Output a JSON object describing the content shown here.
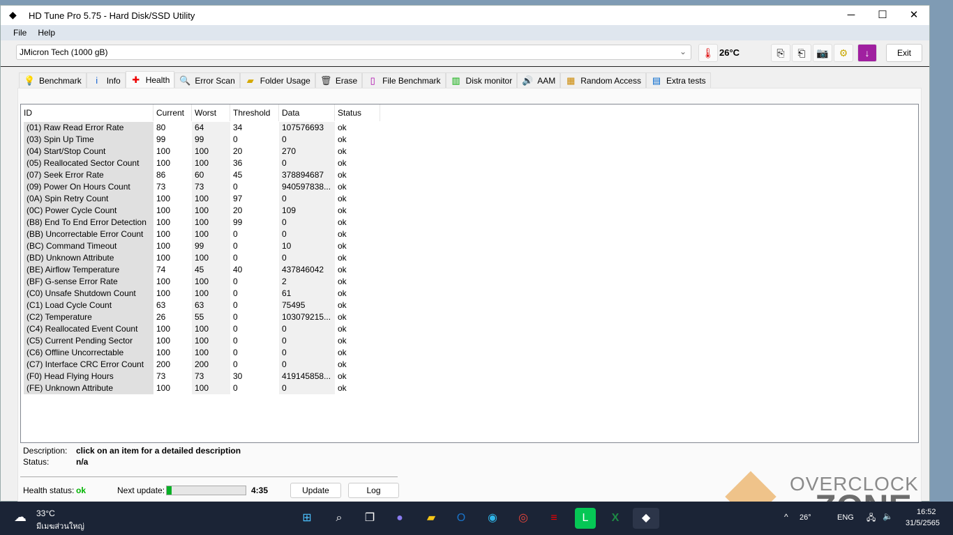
{
  "window": {
    "title": "HD Tune Pro 5.75 - Hard Disk/SSD Utility",
    "minimize": "─",
    "maximize": "☐",
    "close": "✕"
  },
  "menu": [
    "File",
    "Help"
  ],
  "toolbar": {
    "drive": "JMicron Tech (1000 gB)",
    "temperature": "26°C",
    "exit": "Exit"
  },
  "tabs": [
    {
      "label": "Benchmark",
      "icon": "benchmark-icon"
    },
    {
      "label": "Info",
      "icon": "info-icon"
    },
    {
      "label": "Health",
      "icon": "health-icon"
    },
    {
      "label": "Error Scan",
      "icon": "error-scan-icon"
    },
    {
      "label": "Folder Usage",
      "icon": "folder-icon"
    },
    {
      "label": "Erase",
      "icon": "trash-icon"
    },
    {
      "label": "File Benchmark",
      "icon": "file-benchmark-icon"
    },
    {
      "label": "Disk monitor",
      "icon": "disk-monitor-icon"
    },
    {
      "label": "AAM",
      "icon": "speaker-icon"
    },
    {
      "label": "Random Access",
      "icon": "random-access-icon"
    },
    {
      "label": "Extra tests",
      "icon": "extra-tests-icon"
    }
  ],
  "table": {
    "headers": [
      "ID",
      "Current",
      "Worst",
      "Threshold",
      "Data",
      "Status"
    ],
    "rows": [
      [
        "(01) Raw Read Error Rate",
        "80",
        "64",
        "34",
        "107576693",
        "ok"
      ],
      [
        "(03) Spin Up Time",
        "99",
        "99",
        "0",
        "0",
        "ok"
      ],
      [
        "(04) Start/Stop Count",
        "100",
        "100",
        "20",
        "270",
        "ok"
      ],
      [
        "(05) Reallocated Sector Count",
        "100",
        "100",
        "36",
        "0",
        "ok"
      ],
      [
        "(07) Seek Error Rate",
        "86",
        "60",
        "45",
        "378894687",
        "ok"
      ],
      [
        "(09) Power On Hours Count",
        "73",
        "73",
        "0",
        "940597838...",
        "ok"
      ],
      [
        "(0A) Spin Retry Count",
        "100",
        "100",
        "97",
        "0",
        "ok"
      ],
      [
        "(0C) Power Cycle Count",
        "100",
        "100",
        "20",
        "109",
        "ok"
      ],
      [
        "(B8) End To End Error Detection",
        "100",
        "100",
        "99",
        "0",
        "ok"
      ],
      [
        "(BB) Uncorrectable Error Count",
        "100",
        "100",
        "0",
        "0",
        "ok"
      ],
      [
        "(BC) Command Timeout",
        "100",
        "99",
        "0",
        "10",
        "ok"
      ],
      [
        "(BD) Unknown Attribute",
        "100",
        "100",
        "0",
        "0",
        "ok"
      ],
      [
        "(BE) Airflow Temperature",
        "74",
        "45",
        "40",
        "437846042",
        "ok"
      ],
      [
        "(BF) G-sense Error Rate",
        "100",
        "100",
        "0",
        "2",
        "ok"
      ],
      [
        "(C0) Unsafe Shutdown Count",
        "100",
        "100",
        "0",
        "61",
        "ok"
      ],
      [
        "(C1) Load Cycle Count",
        "63",
        "63",
        "0",
        "75495",
        "ok"
      ],
      [
        "(C2) Temperature",
        "26",
        "55",
        "0",
        "103079215...",
        "ok"
      ],
      [
        "(C4) Reallocated Event Count",
        "100",
        "100",
        "0",
        "0",
        "ok"
      ],
      [
        "(C5) Current Pending Sector",
        "100",
        "100",
        "0",
        "0",
        "ok"
      ],
      [
        "(C6) Offline Uncorrectable",
        "100",
        "100",
        "0",
        "0",
        "ok"
      ],
      [
        "(C7) Interface CRC Error Count",
        "200",
        "200",
        "0",
        "0",
        "ok"
      ],
      [
        "(F0) Head Flying Hours",
        "73",
        "73",
        "30",
        "419145858...",
        "ok"
      ],
      [
        "(FE) Unknown Attribute",
        "100",
        "100",
        "0",
        "0",
        "ok"
      ]
    ]
  },
  "details": {
    "description_label": "Description:",
    "description": "click on an item for a detailed description",
    "status_label": "Status:",
    "status": "n/a"
  },
  "footer": {
    "health_label": "Health status:",
    "health": "ok",
    "next_update_label": "Next update:",
    "progress": 0.06,
    "countdown": "4:35",
    "update": "Update",
    "log": "Log"
  },
  "colors": {
    "ok": "#00b400",
    "progress": "#06b025"
  },
  "taskbar": {
    "weather_temp": "33°C",
    "weather_desc": "มีเมฆส่วนใหญ่",
    "tray_temp": "26°",
    "lang": "ENG",
    "time": "16:52",
    "date": "31/5/2565"
  },
  "watermark": "OVERCLOCK ZONE"
}
